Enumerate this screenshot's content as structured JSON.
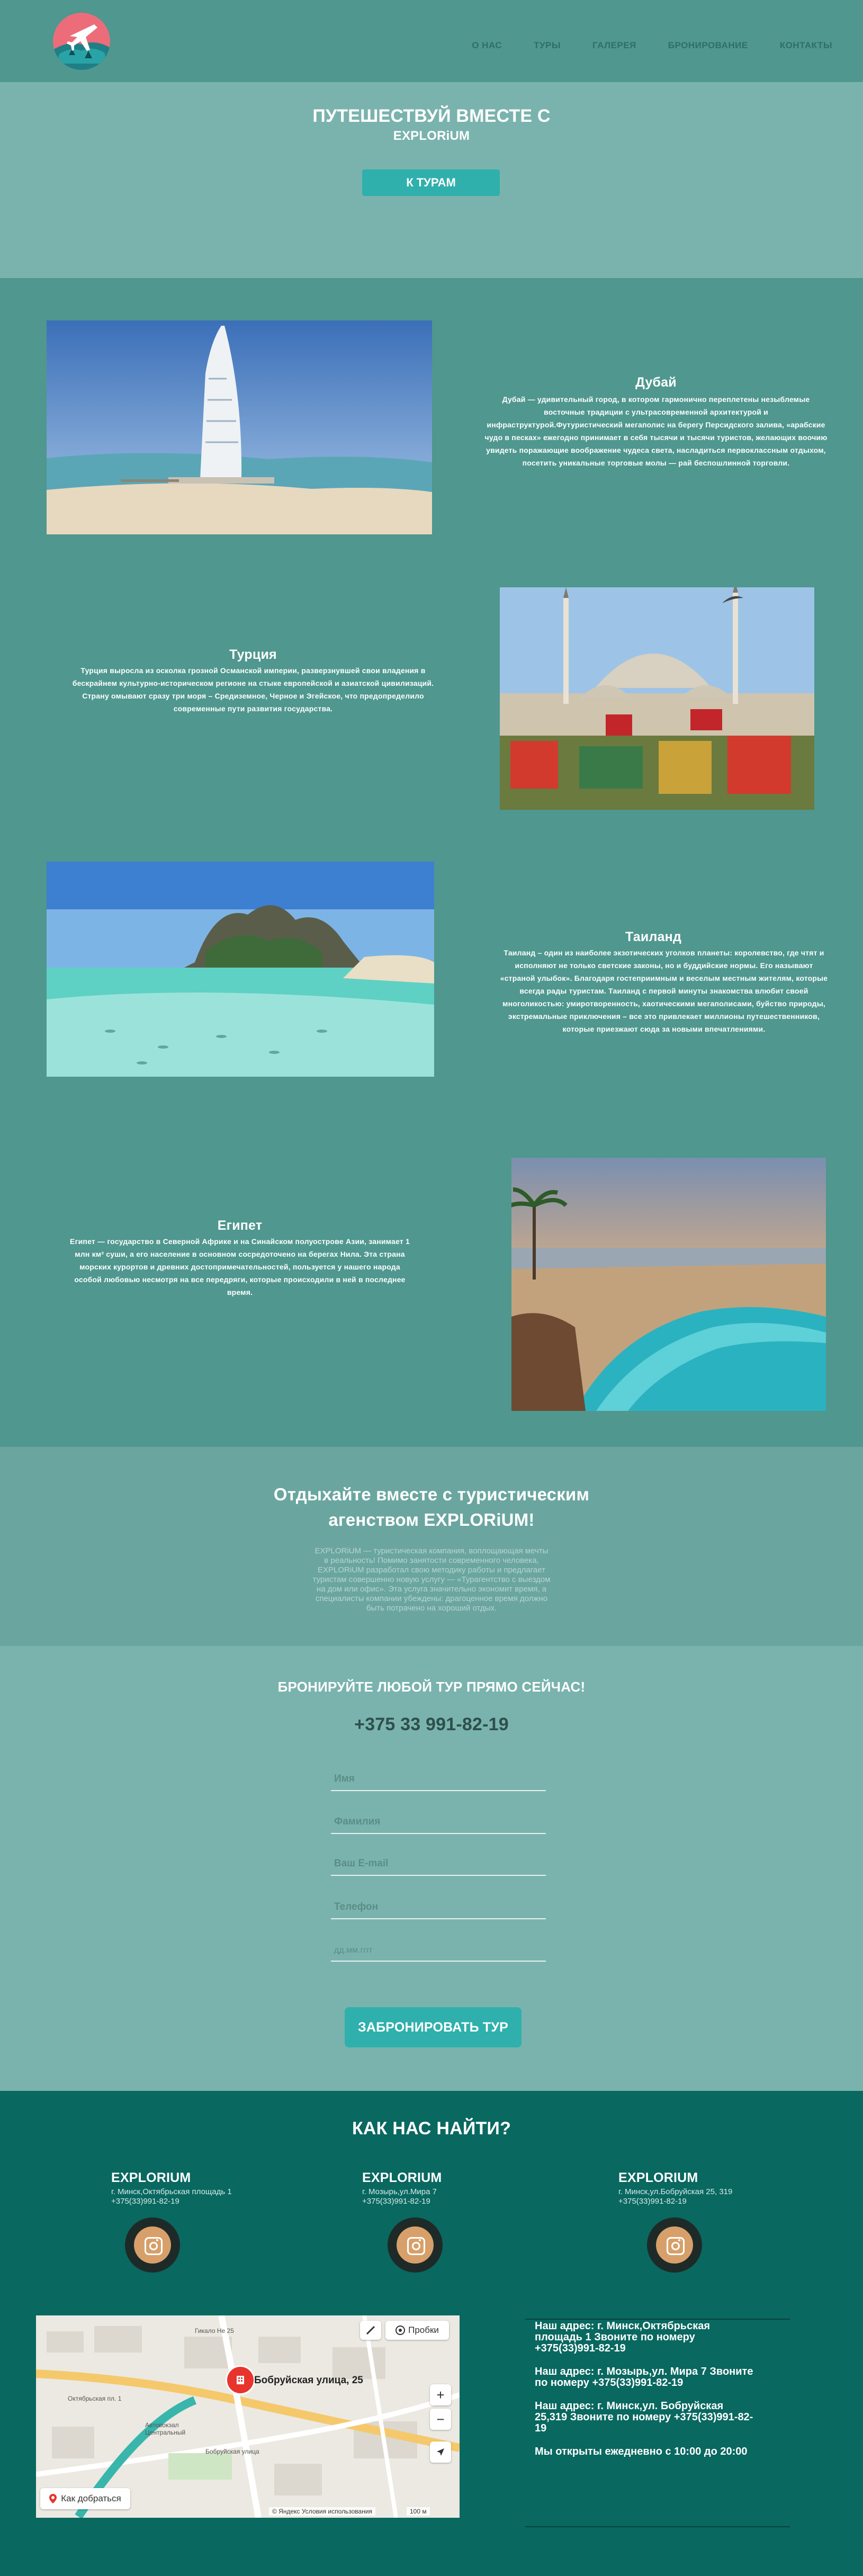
{
  "nav": [
    "О НАС",
    "ТУРЫ",
    "ГАЛЕРЕЯ",
    "БРОНИРОВАНИЕ",
    "КОНТАКТЫ"
  ],
  "hero": {
    "line1": "ПУТЕШЕСТВУЙ ВМЕСТЕ С",
    "line2": "EXPLORiUM",
    "button": "К ТУРАМ"
  },
  "destinations": [
    {
      "title": "Дубай",
      "text": "Дубай — удивительный город, в котором гармонично переплетены незыблемые восточные традиции с ультрасовременной архитектурой и инфраструктурой.Футуристический мегаполис на берегу Персидского залива, «арабские чудо в песках» ежегодно принимает в себя тысячи и тысячи туристов, желающих воочию увидеть поражающие воображение чудеса света, насладиться первоклассным отдыхом, посетить уникальные торговые молы — рай беспошлинной торговли."
    },
    {
      "title": "Турция",
      "text": "Турция выросла из осколка грозной Османской империи, разверзнувшей свои владения в бескрайнем культурно-историческом регионе на стыке европейской и азиатской цивилизаций. Страну омывают сразу три моря – Средиземное, Черное и Эгейское, что предопределило современные пути развития государства."
    },
    {
      "title": "Таиланд",
      "text": "Таиланд – один из наиболее экзотических уголков планеты: королевство, где чтят и исполняют не только светские законы, но и буддийские нормы. Его называют «страной улыбок». Благодаря гостеприимным и веселым местным жителям, которые всегда рады туристам. Таиланд с первой минуты знакомства влюбит своей многоликостью: умиротворенность, хаотическими мегаполисами, буйство природы, экстремальные приключения – все это привлекает миллионы путешественников, которые приезжают сюда за новыми впечатлениями."
    },
    {
      "title": "Египет",
      "text": "Египет — государство в Северной Африке и на Синайском полуострове Азии, занимает 1 млн км² суши, а его население в основном сосредоточено на берегах Нила. Эта страна морских курортов и древних достопримечательностей, пользуется у нашего народа особой любовью несмотря на все передряги, которые происходили в ней в последнее время."
    }
  ],
  "about": {
    "title": "Отдыхайте вместе с туристическим агенством EXPLORiUM!",
    "text": "EXPLORiUM — туристическая компания, воплощающая мечты в реальность! Помимо занятости современного человека, EXPLORiUM разработал свою методику работы и предлагает туристам совершенно новую услугу — «Турагентство с выездом на дом или офис». Эта услуга значительно экономит время, а специалисты компании убеждены: драгоценное время должно быть потрачено на хороший отдых."
  },
  "booking": {
    "title": "БРОНИРУЙТЕ ЛЮБОЙ ТУР ПРЯМО СЕЙЧАС!",
    "phone": "+375 33 991-82-19",
    "fields": [
      "Имя",
      "Фамилия",
      "Ваш E-mail",
      "Телефон",
      "дд.мм.гггг"
    ],
    "button": "ЗАБРОНИРОВАТЬ ТУР"
  },
  "findus": {
    "title": "КАК НАС НАЙТИ?",
    "offices": [
      {
        "name": "EXPLORIUM",
        "address": "г. Минск,Октябрьская площадь 1",
        "phone": "+375(33)991-82-19"
      },
      {
        "name": "EXPLORIUM",
        "address": "г. Мозырь,ул.Мира 7",
        "phone": "+375(33)991-82-19"
      },
      {
        "name": "EXPLORIUM",
        "address": "г. Минск,ул.Бобруйская 25, 319",
        "phone": "+375(33)991-82-19"
      }
    ],
    "info": [
      "Наш адрес: г. Минск,Октябрьская площадь 1 Звоните по номеру +375(33)991-82-19",
      "Наш адрес: г. Мозырь,ул. Мира 7 Звоните по номеру +375(33)991-82-19",
      "Наш адрес: г. Минск,ул. Бобруйская 25,319 Звоните по номеру +375(33)991-82-19",
      "Мы открыты ежедневно с 10:00 до 20:00"
    ]
  },
  "map": {
    "address_label": "Бобруйская улица, 25",
    "traffic_label": "Пробки",
    "route_label": "Как добраться",
    "footer": "© Яндекс  Условия использования",
    "scale": "100 м",
    "streets": [
      "Гикало Не 25",
      "Октябрьская пл. 1",
      "Автовокзал Центральный",
      "Бобруйская улица"
    ]
  }
}
